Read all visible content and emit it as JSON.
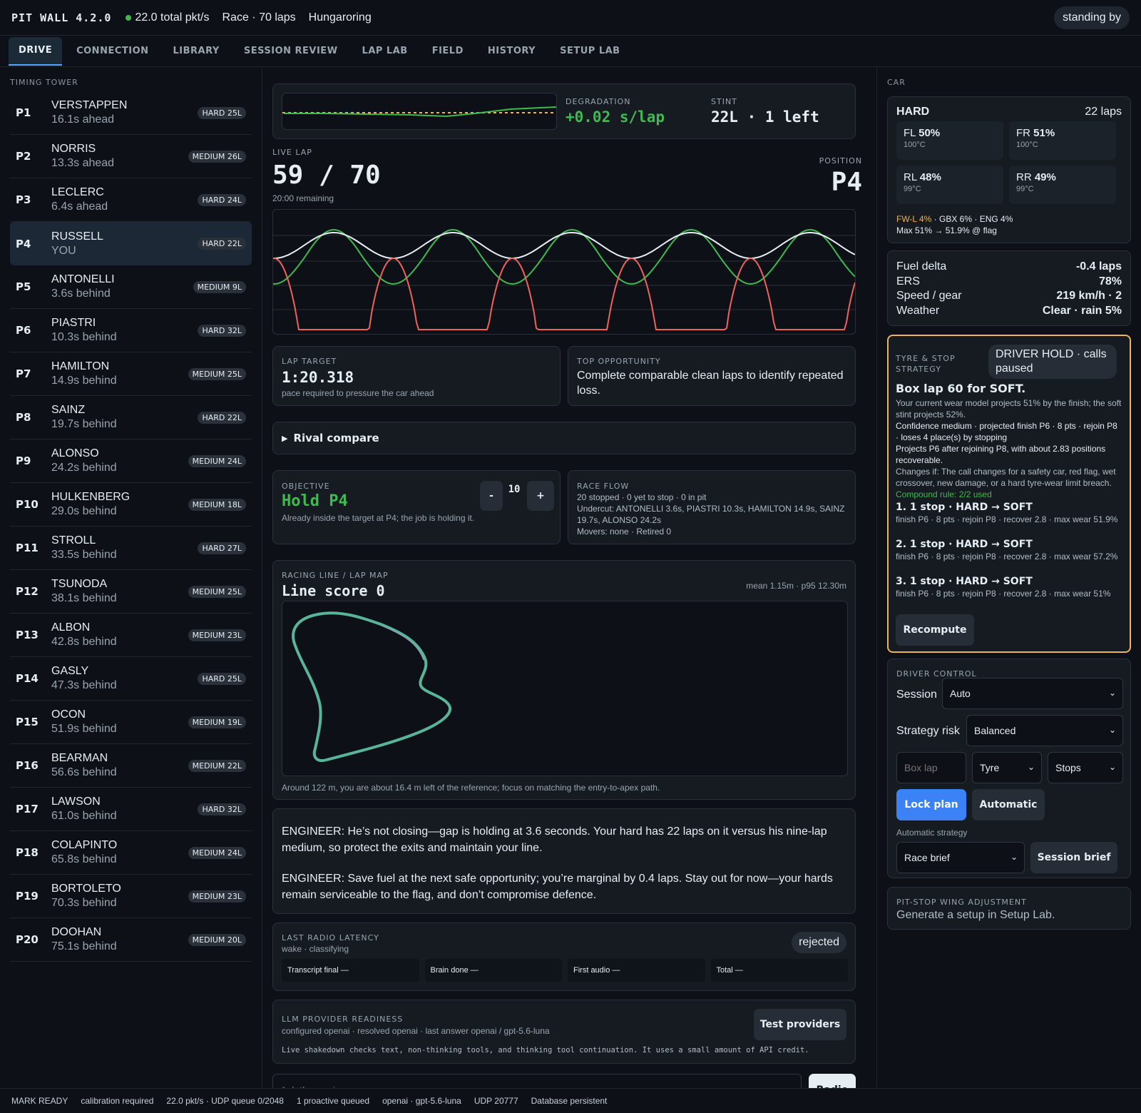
{
  "app": {
    "brand": "PIT WALL 4.2.0",
    "pkt_rate": "22.0 total pkt/s",
    "session": "Race · 70 laps",
    "track": "Hungaroring",
    "status": "standing by"
  },
  "tabs": [
    {
      "label": "DRIVE"
    },
    {
      "label": "CONNECTION"
    },
    {
      "label": "LIBRARY"
    },
    {
      "label": "SESSION REVIEW"
    },
    {
      "label": "LAP LAB"
    },
    {
      "label": "FIELD"
    },
    {
      "label": "HISTORY"
    },
    {
      "label": "SETUP LAB"
    }
  ],
  "timing": {
    "label": "TIMING TOWER",
    "rows": [
      {
        "pos": "P1",
        "name": "VERSTAPPEN",
        "gap": "16.1s ahead",
        "tyre": "HARD 25L"
      },
      {
        "pos": "P2",
        "name": "NORRIS",
        "gap": "13.3s ahead",
        "tyre": "MEDIUM 26L"
      },
      {
        "pos": "P3",
        "name": "LECLERC",
        "gap": "6.4s ahead",
        "tyre": "HARD 24L"
      },
      {
        "pos": "P4",
        "name": "RUSSELL",
        "gap": "YOU",
        "tyre": "HARD 22L"
      },
      {
        "pos": "P5",
        "name": "ANTONELLI",
        "gap": "3.6s behind",
        "tyre": "MEDIUM 9L"
      },
      {
        "pos": "P6",
        "name": "PIASTRI",
        "gap": "10.3s behind",
        "tyre": "HARD 32L"
      },
      {
        "pos": "P7",
        "name": "HAMILTON",
        "gap": "14.9s behind",
        "tyre": "MEDIUM 25L"
      },
      {
        "pos": "P8",
        "name": "SAINZ",
        "gap": "19.7s behind",
        "tyre": "HARD 22L"
      },
      {
        "pos": "P9",
        "name": "ALONSO",
        "gap": "24.2s behind",
        "tyre": "MEDIUM 24L"
      },
      {
        "pos": "P10",
        "name": "HULKENBERG",
        "gap": "29.0s behind",
        "tyre": "MEDIUM 18L"
      },
      {
        "pos": "P11",
        "name": "STROLL",
        "gap": "33.5s behind",
        "tyre": "HARD 27L"
      },
      {
        "pos": "P12",
        "name": "TSUNODA",
        "gap": "38.1s behind",
        "tyre": "MEDIUM 25L"
      },
      {
        "pos": "P13",
        "name": "ALBON",
        "gap": "42.8s behind",
        "tyre": "MEDIUM 23L"
      },
      {
        "pos": "P14",
        "name": "GASLY",
        "gap": "47.3s behind",
        "tyre": "HARD 25L"
      },
      {
        "pos": "P15",
        "name": "OCON",
        "gap": "51.9s behind",
        "tyre": "MEDIUM 19L"
      },
      {
        "pos": "P16",
        "name": "BEARMAN",
        "gap": "56.6s behind",
        "tyre": "MEDIUM 22L"
      },
      {
        "pos": "P17",
        "name": "LAWSON",
        "gap": "61.0s behind",
        "tyre": "HARD 32L"
      },
      {
        "pos": "P18",
        "name": "COLAPINTO",
        "gap": "65.8s behind",
        "tyre": "MEDIUM 24L"
      },
      {
        "pos": "P19",
        "name": "BORTOLETO",
        "gap": "70.3s behind",
        "tyre": "MEDIUM 23L"
      },
      {
        "pos": "P20",
        "name": "DOOHAN",
        "gap": "75.1s behind",
        "tyre": "MEDIUM 20L"
      }
    ]
  },
  "degradation": {
    "label": "DEGRADATION",
    "value": "+0.02 s/lap",
    "stint_label": "STINT",
    "stint_value": "22L · 1 left"
  },
  "live_lap": {
    "label": "LIVE LAP",
    "value": "59 / 70",
    "remaining": "20:00 remaining",
    "position_label": "POSITION",
    "position": "P4"
  },
  "lap_target": {
    "label": "LAP TARGET",
    "value": "1:20.318",
    "note": "pace required to pressure the car ahead"
  },
  "top_opportunity": {
    "label": "TOP OPPORTUNITY",
    "text": "Complete comparable clean laps to identify repeated loss."
  },
  "rival_compare": {
    "label": "Rival compare"
  },
  "objective": {
    "label": "OBJECTIVE",
    "value": "Hold P4",
    "note": "Already inside the target at P4; the job is holding it.",
    "stepper_value": "10",
    "minus": "-",
    "plus": "+"
  },
  "race_flow": {
    "label": "RACE FLOW",
    "line1": "20 stopped · 0 yet to stop · 0 in pit",
    "line2": "Undercut: ANTONELLI 3.6s, PIASTRI 10.3s, HAMILTON 14.9s, SAINZ 19.7s, ALONSO 24.2s",
    "line3": "Movers: none · Retired 0"
  },
  "racing_line": {
    "label": "RACING LINE / LAP MAP",
    "title": "Line score 0",
    "stats": "mean 1.15m · p95 12.30m",
    "note": "Around 122 m, you are about 16.4 m left of the reference; focus on matching the entry-to-apex path."
  },
  "engineer": {
    "msg1": "ENGINEER: He’s not closing—gap is holding at 3.6 seconds. Your hard has 22 laps on it versus his nine-lap medium, so protect the exits and maintain your line.",
    "msg2": "ENGINEER: Save fuel at the next safe opportunity; you’re marginal by 0.4 laps. Stay out for now—your hards remain serviceable to the flag, and don’t compromise defence."
  },
  "latency": {
    "label": "LAST RADIO LATENCY",
    "sub": "wake · classifying",
    "badge": "rejected",
    "cells": [
      "Transcript final —",
      "Brain done —",
      "First audio —",
      "Total —"
    ]
  },
  "llm": {
    "label": "LLM PROVIDER READINESS",
    "sub": "configured openai · resolved openai · last answer openai / gpt-5.6-luna",
    "button": "Test providers",
    "note": "Live shakedown checks text, non-thinking tools, and thinking tool continuation. It uses a small amount of API credit."
  },
  "ask": {
    "placeholder": "Ask the engineer",
    "button": "Radio"
  },
  "car": {
    "label": "CAR",
    "compound": "HARD",
    "laps": "22 laps",
    "tyres": [
      {
        "pos": "FL",
        "wear": "50%",
        "temp": "100°C"
      },
      {
        "pos": "FR",
        "wear": "51%",
        "temp": "100°C"
      },
      {
        "pos": "RL",
        "wear": "48%",
        "temp": "99°C"
      },
      {
        "pos": "RR",
        "wear": "49%",
        "temp": "99°C"
      }
    ],
    "damage_warn": "FW-L 4%",
    "damage_rest": " · GBX 6% · ENG 4%",
    "max_line": "Max 51% → 51.9% @ flag"
  },
  "vitals": [
    {
      "k": "Fuel delta",
      "v": "-0.4 laps"
    },
    {
      "k": "ERS",
      "v": "78%"
    },
    {
      "k": "Speed / gear",
      "v": "219 km/h · 2"
    },
    {
      "k": "Weather",
      "v": "Clear · rain 5%"
    }
  ],
  "strategy": {
    "label": "TYRE & STOP STRATEGY",
    "badge": "DRIVER HOLD · calls paused",
    "headline": "Box lap 60 for SOFT.",
    "p1": "Your current wear model projects 51% by the finish; the soft stint projects 52%.",
    "p2": "Confidence medium · projected finish P6 · 8 pts · rejoin P8 · loses 4 place(s) by stopping",
    "p3": "Projects P6 after rejoining P8, with about 2.83 positions recoverable.",
    "p4": "Changes if: The call changes for a safety car, red flag, wet crossover, new damage, or a hard tyre-wear limit breach.",
    "p5": "Compound rule: 2/2 used",
    "options": [
      {
        "title": "1. 1 stop · HARD → SOFT",
        "detail": "finish P6 · 8 pts · rejoin P8 · recover 2.8 · max wear 51.9%"
      },
      {
        "title": "2. 1 stop · HARD → SOFT",
        "detail": "finish P6 · 8 pts · rejoin P8 · recover 2.8 · max wear 57.2%"
      },
      {
        "title": "3. 1 stop · HARD → SOFT",
        "detail": "finish P6 · 8 pts · rejoin P8 · recover 2.8 · max wear 51%"
      }
    ],
    "button": "Recompute"
  },
  "driver_control": {
    "label": "DRIVER CONTROL",
    "session_label": "Session",
    "session_value": "Auto",
    "risk_label": "Strategy risk",
    "risk_value": "Balanced",
    "box_placeholder": "Box lap",
    "tyre_value": "Tyre",
    "stops_value": "Stops",
    "lock_button": "Lock plan",
    "auto_button": "Automatic",
    "auto_label": "Automatic strategy",
    "brief_value": "Race brief",
    "brief_button": "Session brief"
  },
  "wing": {
    "label": "PIT-STOP WING ADJUSTMENT",
    "text": "Generate a setup in Setup Lab."
  },
  "statusbar": [
    "MARK READY",
    "calibration required",
    "22.0 pkt/s · UDP queue 0/2048",
    "1 proactive queued",
    "openai · gpt-5.6-luna",
    "UDP 20777",
    "Database persistent"
  ],
  "colors": {
    "accent": "#3b82f6",
    "good": "#3fb950",
    "warn": "#f0b35a",
    "bad": "#f0625a"
  }
}
